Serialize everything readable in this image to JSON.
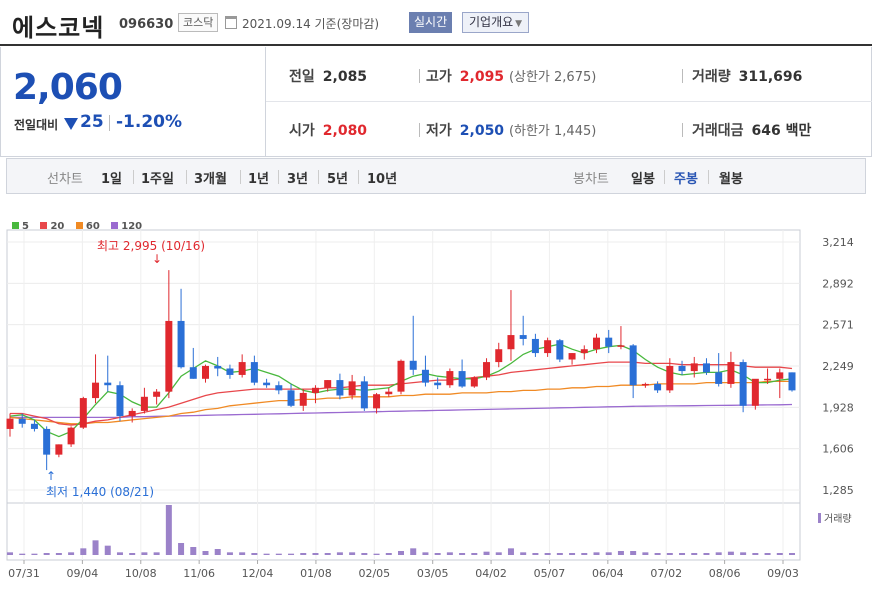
{
  "header": {
    "stock_name": "에스코넥",
    "stock_code": "096630",
    "market": "코스닥",
    "date": "2021.09.14 기준(장마감)",
    "realtime_label": "실시간",
    "overview_label": "기업개요"
  },
  "price": {
    "current": "2,060",
    "change_label": "전일대비",
    "change_value": "25",
    "change_pct": "-1.20%"
  },
  "stats": {
    "prev_close_label": "전일",
    "prev_close": "2,085",
    "high_label": "고가",
    "high": "2,095",
    "upper_limit": "(상한가 2,675)",
    "volume_label": "거래량",
    "volume": "311,696",
    "open_label": "시가",
    "open": "2,080",
    "low_label": "저가",
    "low": "2,050",
    "lower_limit": "(하한가 1,445)",
    "value_label": "거래대금",
    "value": "646 백만"
  },
  "periods": {
    "line_label": "선차트",
    "line_items": [
      "1일",
      "1주일",
      "3개월",
      "1년",
      "3년",
      "5년",
      "10년"
    ],
    "candle_label": "봉차트",
    "candle_items": [
      "일봉",
      "주봉",
      "월봉"
    ],
    "active": "주봉"
  },
  "legend": [
    {
      "label": "5",
      "color": "#49b83d"
    },
    {
      "label": "20",
      "color": "#e8474b"
    },
    {
      "label": "60",
      "color": "#f08a24"
    },
    {
      "label": "120",
      "color": "#9a6ad0"
    }
  ],
  "chart_data": {
    "type": "candlestick",
    "y_ticks": [
      "3,214",
      "2,892",
      "2,571",
      "2,249",
      "1,928",
      "1,606",
      "1,285"
    ],
    "x_ticks": [
      "07/31",
      "09/04",
      "10/08",
      "11/06",
      "12/04",
      "01/08",
      "02/05",
      "03/05",
      "04/02",
      "05/07",
      "06/04",
      "07/02",
      "08/06",
      "09/03"
    ],
    "ylim": [
      1285,
      3214
    ],
    "high_annotation": "최고 2,995 (10/16)",
    "low_annotation": "최저 1,440 (08/21)",
    "volume_label": "거래량",
    "candles": [
      [
        1760,
        1880,
        1700,
        1840
      ],
      [
        1840,
        1880,
        1770,
        1800
      ],
      [
        1800,
        1830,
        1740,
        1760
      ],
      [
        1760,
        1780,
        1440,
        1560
      ],
      [
        1560,
        1640,
        1540,
        1640
      ],
      [
        1640,
        1780,
        1620,
        1770
      ],
      [
        1770,
        2010,
        1760,
        2000
      ],
      [
        2000,
        2340,
        1960,
        2120
      ],
      [
        2120,
        2330,
        2050,
        2100
      ],
      [
        2100,
        2130,
        1820,
        1860
      ],
      [
        1860,
        1920,
        1810,
        1900
      ],
      [
        1900,
        2080,
        1880,
        2010
      ],
      [
        2010,
        2070,
        1950,
        2050
      ],
      [
        2050,
        2995,
        2000,
        2600
      ],
      [
        2600,
        2850,
        2230,
        2240
      ],
      [
        2240,
        2390,
        2150,
        2150
      ],
      [
        2150,
        2260,
        2120,
        2250
      ],
      [
        2250,
        2320,
        2170,
        2230
      ],
      [
        2230,
        2260,
        2150,
        2180
      ],
      [
        2180,
        2340,
        2160,
        2280
      ],
      [
        2280,
        2330,
        2100,
        2120
      ],
      [
        2120,
        2150,
        2080,
        2100
      ],
      [
        2100,
        2130,
        2030,
        2060
      ],
      [
        2060,
        2110,
        1930,
        1940
      ],
      [
        1940,
        2070,
        1900,
        2040
      ],
      [
        2040,
        2100,
        1960,
        2080
      ],
      [
        2080,
        2140,
        2050,
        2140
      ],
      [
        2140,
        2190,
        1990,
        2020
      ],
      [
        2020,
        2180,
        1990,
        2130
      ],
      [
        2130,
        2170,
        1900,
        1920
      ],
      [
        1920,
        2040,
        1880,
        2030
      ],
      [
        2030,
        2080,
        2010,
        2050
      ],
      [
        2050,
        2300,
        2030,
        2290
      ],
      [
        2290,
        2640,
        2180,
        2220
      ],
      [
        2220,
        2330,
        2090,
        2120
      ],
      [
        2120,
        2160,
        2070,
        2100
      ],
      [
        2100,
        2230,
        2080,
        2210
      ],
      [
        2210,
        2300,
        2080,
        2090
      ],
      [
        2090,
        2170,
        2080,
        2160
      ],
      [
        2160,
        2310,
        2140,
        2280
      ],
      [
        2280,
        2430,
        2240,
        2380
      ],
      [
        2380,
        2840,
        2290,
        2490
      ],
      [
        2490,
        2640,
        2410,
        2460
      ],
      [
        2460,
        2500,
        2320,
        2350
      ],
      [
        2350,
        2470,
        2320,
        2450
      ],
      [
        2450,
        2460,
        2280,
        2300
      ],
      [
        2300,
        2350,
        2260,
        2350
      ],
      [
        2350,
        2410,
        2300,
        2380
      ],
      [
        2380,
        2500,
        2350,
        2470
      ],
      [
        2470,
        2530,
        2350,
        2400
      ],
      [
        2400,
        2560,
        2380,
        2410
      ],
      [
        2410,
        2420,
        2000,
        2100
      ],
      [
        2100,
        2120,
        2080,
        2110
      ],
      [
        2110,
        2130,
        2040,
        2060
      ],
      [
        2060,
        2310,
        2040,
        2250
      ],
      [
        2250,
        2290,
        2180,
        2210
      ],
      [
        2210,
        2320,
        2160,
        2270
      ],
      [
        2270,
        2310,
        2180,
        2200
      ],
      [
        2200,
        2350,
        2090,
        2110
      ],
      [
        2110,
        2360,
        2080,
        2280
      ],
      [
        2280,
        2300,
        1890,
        1940
      ],
      [
        1940,
        2100,
        1910,
        2150
      ],
      [
        2150,
        2230,
        2110,
        2150
      ],
      [
        2150,
        2230,
        2000,
        2200
      ],
      [
        2200,
        2200,
        2050,
        2060
      ]
    ],
    "volumes": [
      4,
      2,
      2,
      3,
      3,
      4,
      10,
      22,
      14,
      4,
      3,
      4,
      4,
      75,
      18,
      12,
      6,
      9,
      4,
      4,
      3,
      2,
      2,
      2,
      3,
      3,
      3,
      4,
      4,
      3,
      2,
      3,
      6,
      10,
      4,
      3,
      4,
      3,
      3,
      5,
      4,
      10,
      4,
      3,
      3,
      3,
      3,
      3,
      4,
      4,
      6,
      6,
      4,
      3,
      3,
      3,
      3,
      3,
      4,
      5,
      4,
      3,
      3,
      3,
      3
    ],
    "ma5": [
      1860,
      1870,
      1830,
      1740,
      1700,
      1740,
      1840,
      1950,
      2050,
      2030,
      1970,
      1930,
      1930,
      2040,
      2170,
      2230,
      2290,
      2250,
      2200,
      2210,
      2230,
      2200,
      2170,
      2110,
      2060,
      2040,
      2060,
      2070,
      2070,
      2060,
      2070,
      2080,
      2130,
      2170,
      2190,
      2170,
      2160,
      2150,
      2150,
      2170,
      2210,
      2270,
      2340,
      2380,
      2400,
      2420,
      2380,
      2350,
      2380,
      2400,
      2410,
      2370,
      2300,
      2240,
      2200,
      2180,
      2190,
      2200,
      2200,
      2220,
      2180,
      2120,
      2120,
      2140,
      2150
    ],
    "ma20": [
      1880,
      1880,
      1860,
      1840,
      1800,
      1790,
      1800,
      1820,
      1830,
      1850,
      1870,
      1890,
      1910,
      1930,
      1960,
      1990,
      2020,
      2040,
      2050,
      2060,
      2070,
      2070,
      2070,
      2070,
      2070,
      2070,
      2080,
      2080,
      2090,
      2100,
      2100,
      2100,
      2110,
      2120,
      2130,
      2140,
      2140,
      2150,
      2160,
      2170,
      2180,
      2200,
      2210,
      2220,
      2230,
      2240,
      2250,
      2260,
      2270,
      2280,
      2280,
      2280,
      2270,
      2270,
      2270,
      2260,
      2260,
      2260,
      2260,
      2260,
      2250,
      2240,
      2240,
      2240,
      2230
    ],
    "ma60": [
      1850,
      1840,
      1830,
      1820,
      1810,
      1800,
      1800,
      1810,
      1810,
      1820,
      1830,
      1840,
      1850,
      1860,
      1880,
      1890,
      1910,
      1920,
      1940,
      1950,
      1960,
      1970,
      1980,
      1980,
      1990,
      1990,
      2000,
      2000,
      2010,
      2010,
      2010,
      2010,
      2020,
      2020,
      2030,
      2030,
      2030,
      2040,
      2040,
      2040,
      2050,
      2050,
      2060,
      2060,
      2070,
      2070,
      2080,
      2080,
      2090,
      2090,
      2100,
      2100,
      2100,
      2110,
      2110,
      2110,
      2110,
      2120,
      2120,
      2120,
      2120,
      2120,
      2130,
      2130,
      2130
    ],
    "ma120": [
      1850,
      1850,
      1850,
      1850,
      1850,
      1850,
      1850,
      1850,
      1850,
      1850,
      1855,
      1855,
      1858,
      1860,
      1862,
      1864,
      1866,
      1868,
      1870,
      1872,
      1874,
      1876,
      1878,
      1880,
      1882,
      1884,
      1886,
      1888,
      1890,
      1892,
      1894,
      1896,
      1898,
      1900,
      1902,
      1904,
      1906,
      1908,
      1910,
      1912,
      1914,
      1916,
      1918,
      1920,
      1922,
      1924,
      1926,
      1928,
      1930,
      1932,
      1934,
      1936,
      1937,
      1938,
      1939,
      1940,
      1941,
      1942,
      1943,
      1944,
      1945,
      1946,
      1947,
      1948,
      1950
    ]
  }
}
